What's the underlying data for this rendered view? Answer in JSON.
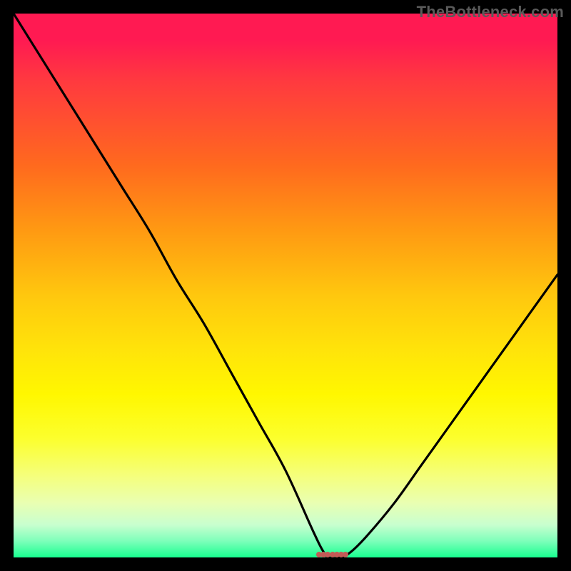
{
  "watermark": "TheBottleneck.com",
  "marker_color": "#c35a56",
  "chart_data": {
    "type": "line",
    "title": "",
    "xlabel": "",
    "ylabel": "",
    "xlim": [
      0,
      100
    ],
    "ylim": [
      0,
      100
    ],
    "series": [
      {
        "name": "bottleneck-curve",
        "x": [
          0,
          5,
          10,
          15,
          20,
          25,
          30,
          35,
          40,
          45,
          50,
          55,
          57,
          58,
          60,
          62,
          65,
          70,
          75,
          80,
          85,
          90,
          95,
          100
        ],
        "values": [
          100,
          92,
          84,
          76,
          68,
          60,
          51,
          43,
          34,
          25,
          16,
          5,
          1,
          0,
          0,
          1,
          4,
          10,
          17,
          24,
          31,
          38,
          45,
          52
        ]
      }
    ],
    "marker_cluster": {
      "y": 0,
      "x_values": [
        56.2,
        57.0,
        57.8,
        58.6,
        59.4,
        60.2,
        61.0
      ]
    },
    "background_gradient": {
      "type": "vertical",
      "stops": [
        {
          "pos": 0.0,
          "color": "#ff1a52"
        },
        {
          "pos": 0.28,
          "color": "#ff6a1e"
        },
        {
          "pos": 0.52,
          "color": "#ffc80e"
        },
        {
          "pos": 0.7,
          "color": "#fff700"
        },
        {
          "pos": 0.9,
          "color": "#e9ffb2"
        },
        {
          "pos": 1.0,
          "color": "#18ff90"
        }
      ]
    }
  }
}
